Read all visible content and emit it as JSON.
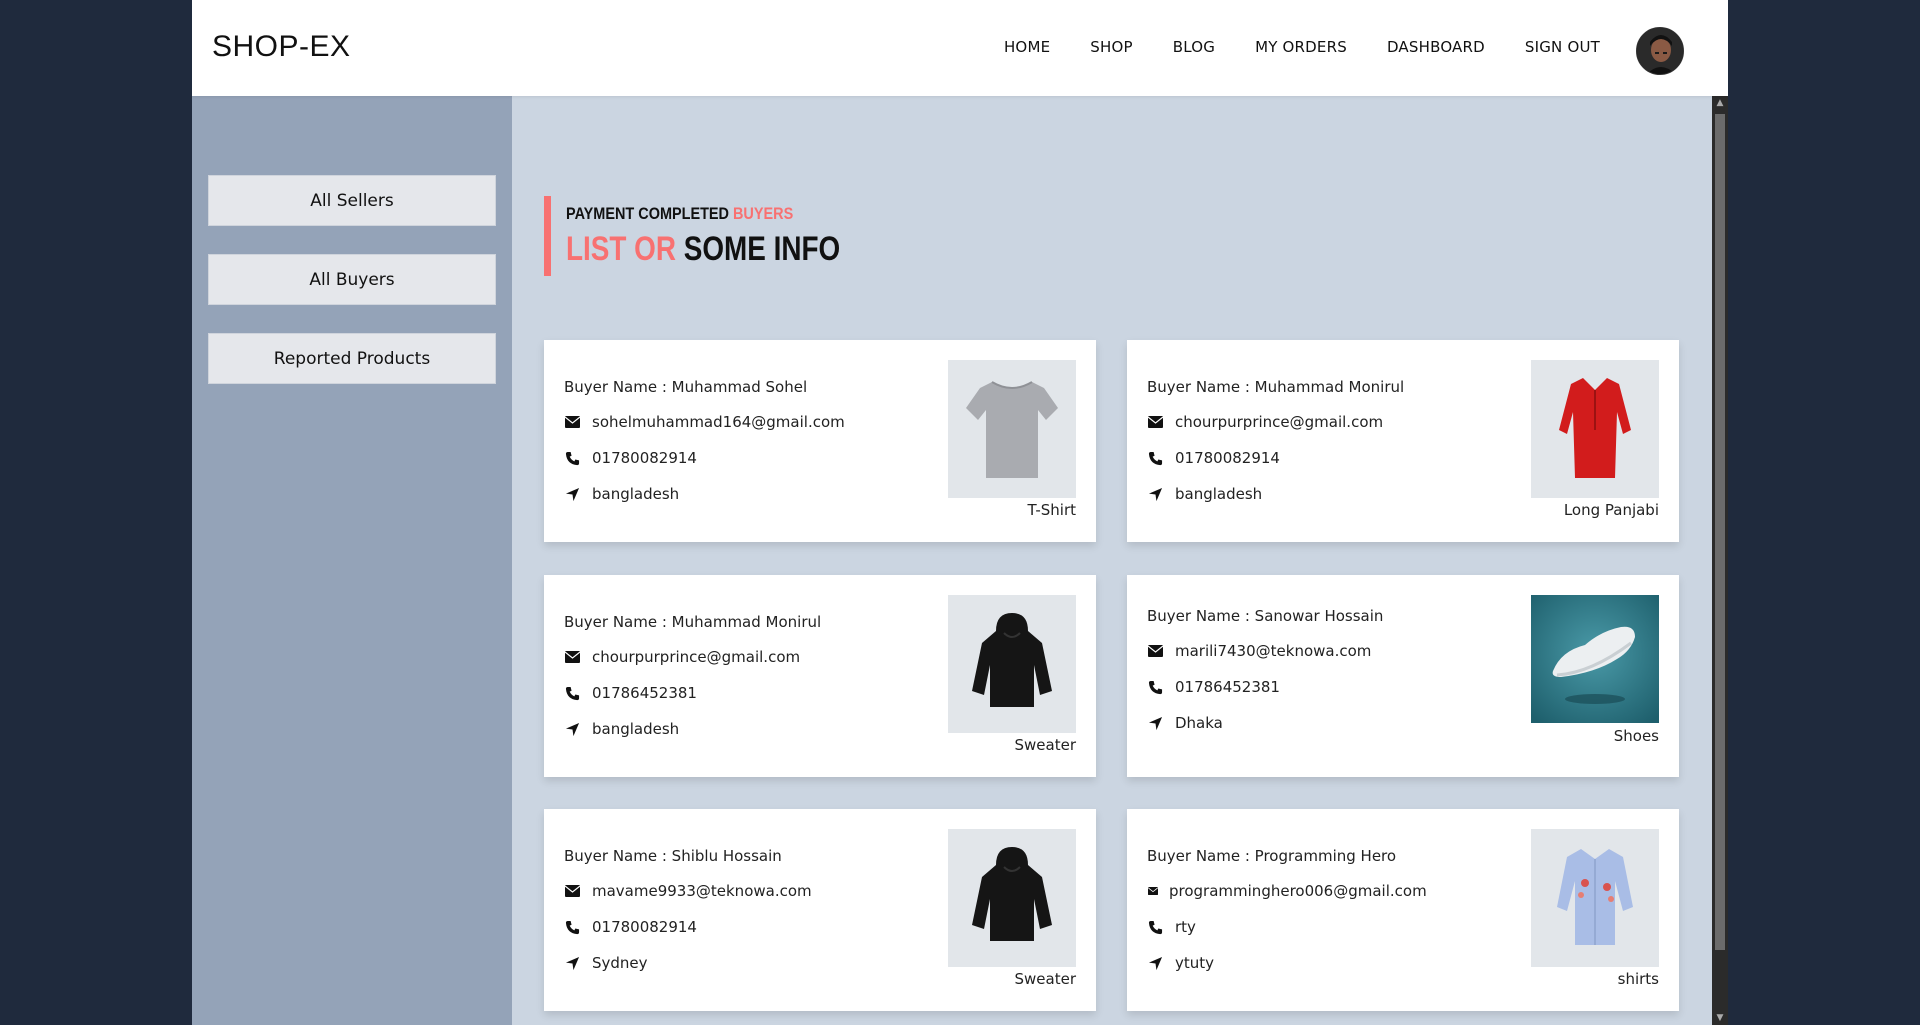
{
  "app": {
    "logo": "SHOP-EX"
  },
  "nav": [
    "HOME",
    "SHOP",
    "BLOG",
    "MY ORDERS",
    "DASHBOARD",
    "SIGN OUT"
  ],
  "sidebar": {
    "items": [
      "All Sellers",
      "All Buyers",
      "Reported Products"
    ]
  },
  "heading": {
    "sub_black": "PAYMENT COMPLETED ",
    "sub_red": "BUYERS",
    "title_red": "LIST OR ",
    "title_black": "SOME INFO"
  },
  "buyers": [
    {
      "name": "Buyer Name : Muhammad Sohel",
      "email": "sohelmuhammad164@gmail.com",
      "phone": "01780082914",
      "location": "bangladesh",
      "product": "T-Shirt",
      "image": "tshirt-grey"
    },
    {
      "name": "Buyer Name : Muhammad Monirul",
      "email": "chourpurprince@gmail.com",
      "phone": "01780082914",
      "location": "bangladesh",
      "product": "Long Panjabi",
      "image": "panjabi-red"
    },
    {
      "name": "Buyer Name : Muhammad Monirul",
      "email": "chourpurprince@gmail.com",
      "phone": "01786452381",
      "location": "bangladesh",
      "product": "Sweater",
      "image": "hoodie-black"
    },
    {
      "name": "Buyer Name : Sanowar Hossain",
      "email": "marili7430@teknowa.com",
      "phone": "01786452381",
      "location": "Dhaka",
      "product": "Shoes",
      "image": "sneaker-white"
    },
    {
      "name": "Buyer Name : Shiblu Hossain",
      "email": "mavame9933@teknowa.com",
      "phone": "01780082914",
      "location": "Sydney",
      "product": "Sweater",
      "image": "hoodie-black"
    },
    {
      "name": "Buyer Name : Programming Hero",
      "email": "programminghero006@gmail.com",
      "phone": "rty",
      "location": "ytuty",
      "product": "shirts",
      "image": "shirt-blue"
    }
  ],
  "icons": {
    "email": "envelope-icon",
    "phone": "phone-icon",
    "location": "location-arrow-icon"
  },
  "colors": {
    "accent": "#f87171",
    "sidebar": "#94a3b8",
    "main_bg": "#cbd5e1",
    "page_bg": "#1f2a3d"
  }
}
